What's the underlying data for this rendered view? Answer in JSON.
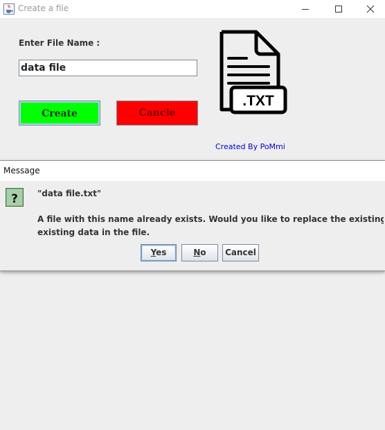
{
  "window": {
    "title": "Create a file",
    "icon": "java-cup-icon"
  },
  "form": {
    "file_name_label": "Enter File Name :",
    "file_name_value": "data file",
    "create_label": "Create",
    "cancel_label": "Cancle",
    "file_icon_text": ".TXT",
    "credit": "Created By PoMmi"
  },
  "dialog": {
    "title": "Message",
    "icon": "question-icon",
    "file_name": "\"data file.txt\"",
    "message_line1": "A file with this name already exists. Would you like to replace the existing? It could erase",
    "message_line2": "existing data in the file.",
    "buttons": {
      "yes_first": "Y",
      "yes_rest": "es",
      "no_first": "N",
      "no_rest": "o",
      "cancel": "Cancel"
    }
  },
  "colors": {
    "create_button": "#00ff00",
    "cancel_button": "#ff0000",
    "credit_text": "#0000cc",
    "background": "#eeeeee"
  }
}
